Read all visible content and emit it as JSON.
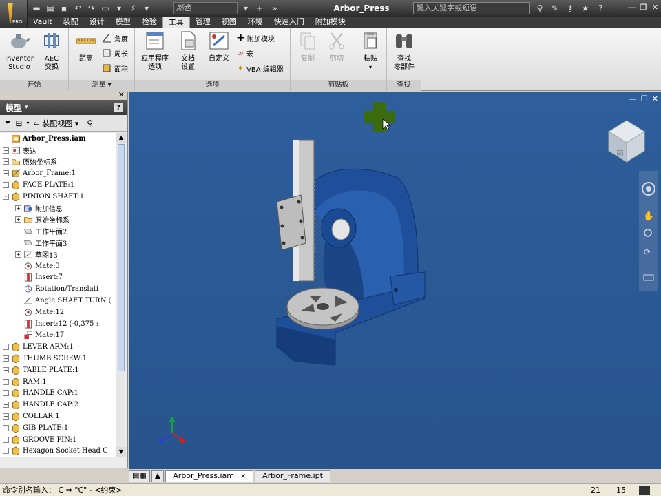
{
  "window": {
    "title": "Arbor_Press",
    "color_selector": "颜色",
    "search_placeholder": "键入关键字或短语",
    "pro_badge": "PRO"
  },
  "ribbon": {
    "tabs": [
      "Vault",
      "装配",
      "设计",
      "模型",
      "检验",
      "工具",
      "管理",
      "视图",
      "环境",
      "快速入门",
      "附加模块"
    ],
    "active_tab": "工具",
    "groups": {
      "start": {
        "label": "开始",
        "inventor_studio": "Inventor\nStudio",
        "aec": "AEC\n交换"
      },
      "measure": {
        "label": "测量",
        "distance": "距离",
        "angle": "角度",
        "perimeter": "周长",
        "area": "面积"
      },
      "options": {
        "label": "选项",
        "app_options": "应用程序\n选项",
        "doc_settings": "文档\n设置",
        "customize": "自定义",
        "addin": "附加模块",
        "macro": "宏",
        "vba": "VBA 编辑器"
      },
      "clipboard": {
        "label": "剪贴板",
        "copy": "复制",
        "cut": "剪切",
        "paste": "粘贴"
      },
      "find": {
        "label": "查找",
        "find_component": "查找\n零部件"
      }
    }
  },
  "browser": {
    "title": "模型",
    "help": "?",
    "view_mode": "装配视图",
    "tree": [
      {
        "label": "Arbor_Press.iam",
        "level": 0,
        "exp": "",
        "icon": "assembly-icon",
        "root": true
      },
      {
        "label": "表达",
        "level": 0,
        "exp": "+",
        "icon": "representation-icon"
      },
      {
        "label": "原始坐标系",
        "level": 0,
        "exp": "+",
        "icon": "folder-icon"
      },
      {
        "label": "Arbor_Frame:1",
        "level": 0,
        "exp": "+",
        "icon": "part-grounded-icon"
      },
      {
        "label": "FACE PLATE:1",
        "level": 0,
        "exp": "+",
        "icon": "part-icon"
      },
      {
        "label": "PINION SHAFT:1",
        "level": 0,
        "exp": "-",
        "icon": "part-icon"
      },
      {
        "label": "附加信息",
        "level": 1,
        "exp": "+",
        "icon": "info-icon"
      },
      {
        "label": "原始坐标系",
        "level": 1,
        "exp": "+",
        "icon": "folder-icon"
      },
      {
        "label": "工作平面2",
        "level": 1,
        "exp": "",
        "icon": "workplane-icon"
      },
      {
        "label": "工作平面3",
        "level": 1,
        "exp": "",
        "icon": "workplane-icon"
      },
      {
        "label": "草图13",
        "level": 1,
        "exp": "+",
        "icon": "sketch-icon"
      },
      {
        "label": "Mate:3",
        "level": 1,
        "exp": "",
        "icon": "mate-icon"
      },
      {
        "label": "Insert:7",
        "level": 1,
        "exp": "",
        "icon": "insert-icon"
      },
      {
        "label": "Rotation/Translati",
        "level": 1,
        "exp": "",
        "icon": "rotation-icon"
      },
      {
        "label": "Angle SHAFT TURN (",
        "level": 1,
        "exp": "",
        "icon": "angle-icon"
      },
      {
        "label": "Mate:12",
        "level": 1,
        "exp": "",
        "icon": "mate-icon"
      },
      {
        "label": "Insert:12 (-0,375 :",
        "level": 1,
        "exp": "",
        "icon": "insert-icon"
      },
      {
        "label": "Mate:17",
        "level": 1,
        "exp": "",
        "icon": "mate-red-icon"
      },
      {
        "label": "LEVER ARM:1",
        "level": 0,
        "exp": "+",
        "icon": "part-icon"
      },
      {
        "label": "THUMB SCREW:1",
        "level": 0,
        "exp": "+",
        "icon": "part-icon"
      },
      {
        "label": "TABLE PLATE:1",
        "level": 0,
        "exp": "+",
        "icon": "part-icon"
      },
      {
        "label": "RAM:1",
        "level": 0,
        "exp": "+",
        "icon": "part-icon"
      },
      {
        "label": "HANDLE CAP:1",
        "level": 0,
        "exp": "+",
        "icon": "part-icon"
      },
      {
        "label": "HANDLE CAP:2",
        "level": 0,
        "exp": "+",
        "icon": "part-icon"
      },
      {
        "label": "COLLAR:1",
        "level": 0,
        "exp": "+",
        "icon": "part-icon"
      },
      {
        "label": "GIB PLATE:1",
        "level": 0,
        "exp": "+",
        "icon": "part-icon"
      },
      {
        "label": "GROOVE PIN:1",
        "level": 0,
        "exp": "+",
        "icon": "part-icon"
      },
      {
        "label": "Hexagon Socket Head C",
        "level": 0,
        "exp": "+",
        "icon": "part-icon"
      }
    ]
  },
  "viewcube": {
    "face_label": "前"
  },
  "doc_tabs": [
    {
      "label": "Arbor_Press.iam",
      "active": true
    },
    {
      "label": "Arbor_Frame.ipt",
      "active": false
    }
  ],
  "status": {
    "prompt": "命令别名输入： C  ⇒ \"C\" - <约束>",
    "count_a": "21",
    "count_b": "15"
  },
  "colors": {
    "viewport_bg": "#2d5c99",
    "frame_blue": "#1f4f9a",
    "accent_green": "#3b6b0e"
  }
}
